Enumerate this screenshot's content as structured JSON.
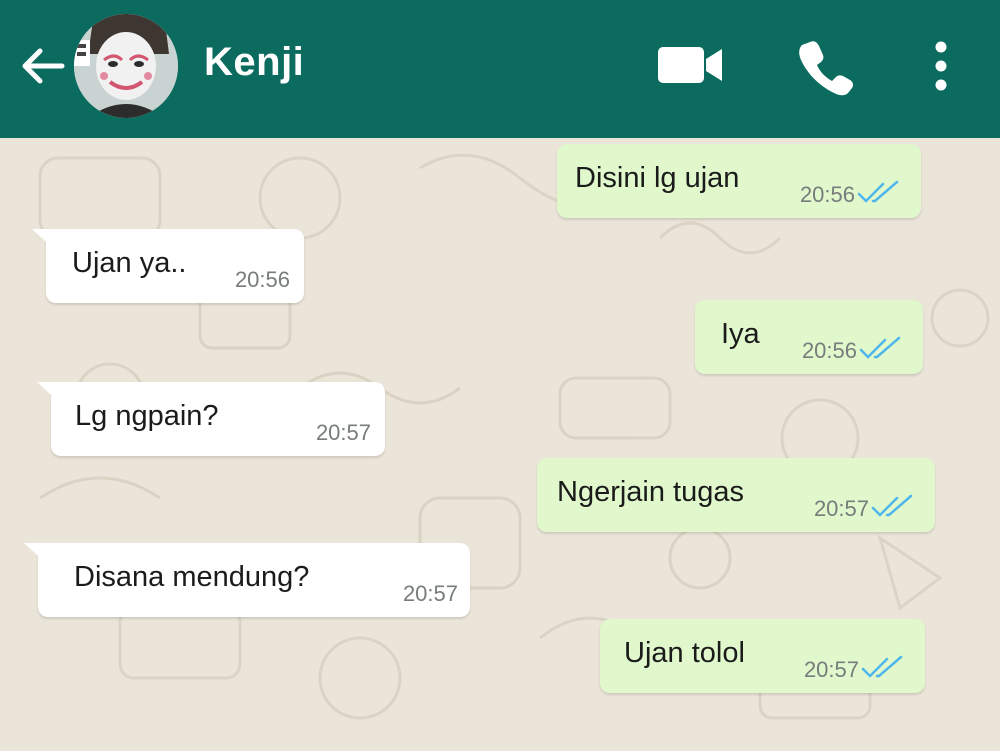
{
  "header": {
    "contact_name": "Kenji",
    "icons": [
      "back-arrow-icon",
      "video-call-icon",
      "voice-call-icon",
      "more-options-icon"
    ],
    "color": "#0c6b5f"
  },
  "messages": [
    {
      "direction": "outgoing",
      "text": "Disini lg ujan",
      "time": "20:56",
      "status": "read"
    },
    {
      "direction": "incoming",
      "text": "Ujan ya..",
      "time": "20:56"
    },
    {
      "direction": "outgoing",
      "text": "Iya",
      "time": "20:56",
      "status": "read"
    },
    {
      "direction": "incoming",
      "text": "Lg ngpain?",
      "time": "20:57"
    },
    {
      "direction": "outgoing",
      "text": "Ngerjain tugas",
      "time": "20:57",
      "status": "read"
    },
    {
      "direction": "incoming",
      "text": "Disana mendung?",
      "time": "20:57"
    },
    {
      "direction": "outgoing",
      "text": "Ujan tolol",
      "time": "20:57",
      "status": "read"
    }
  ],
  "colors": {
    "outgoing_bubble": "#e0f8cb",
    "incoming_bubble": "#ffffff",
    "read_ticks": "#4fb6ec",
    "wallpaper": "#ebe5d9"
  }
}
